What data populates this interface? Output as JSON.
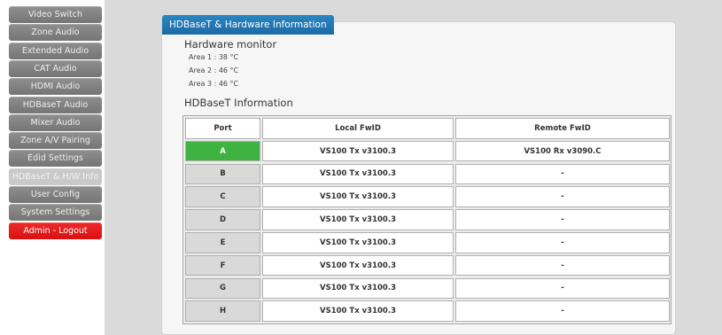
{
  "sidebar": {
    "items": [
      {
        "label": "Video Switch",
        "state": "normal"
      },
      {
        "label": "Zone Audio",
        "state": "normal"
      },
      {
        "label": "Extended Audio",
        "state": "normal"
      },
      {
        "label": "CAT Audio",
        "state": "normal"
      },
      {
        "label": "HDMI Audio",
        "state": "normal"
      },
      {
        "label": "HDBaseT Audio",
        "state": "normal"
      },
      {
        "label": "Mixer Audio",
        "state": "normal"
      },
      {
        "label": "Zone A/V Pairing",
        "state": "normal"
      },
      {
        "label": "Edid Settings",
        "state": "normal"
      },
      {
        "label": "HDBaseT & H/W Info",
        "state": "active"
      },
      {
        "label": "User Config",
        "state": "normal"
      },
      {
        "label": "System Settings",
        "state": "normal"
      },
      {
        "label": "Admin - Logout",
        "state": "logout"
      }
    ]
  },
  "panel": {
    "tab_title": "HDBaseT & Hardware Information",
    "hardware_title": "Hardware monitor",
    "areas": [
      "Area 1 : 38 °C",
      "Area 2 : 46 °C",
      "Area 3 : 46 °C"
    ],
    "info_title": "HDBaseT Information"
  },
  "table": {
    "headers": [
      "Port",
      "Local FwID",
      "Remote FwID"
    ],
    "rows": [
      {
        "port": "A",
        "local": "VS100 Tx v3100.3",
        "remote": "VS100 Rx v3090.C",
        "active": true
      },
      {
        "port": "B",
        "local": "VS100 Tx v3100.3",
        "remote": "-",
        "active": false
      },
      {
        "port": "C",
        "local": "VS100 Tx v3100.3",
        "remote": "-",
        "active": false
      },
      {
        "port": "D",
        "local": "VS100 Tx v3100.3",
        "remote": "-",
        "active": false
      },
      {
        "port": "E",
        "local": "VS100 Tx v3100.3",
        "remote": "-",
        "active": false
      },
      {
        "port": "F",
        "local": "VS100 Tx v3100.3",
        "remote": "-",
        "active": false
      },
      {
        "port": "G",
        "local": "VS100 Tx v3100.3",
        "remote": "-",
        "active": false
      },
      {
        "port": "H",
        "local": "VS100 Tx v3100.3",
        "remote": "-",
        "active": false
      }
    ]
  },
  "colors": {
    "accent": "#1f73b0",
    "active_port": "#3fb342",
    "logout": "#e31b1b"
  }
}
